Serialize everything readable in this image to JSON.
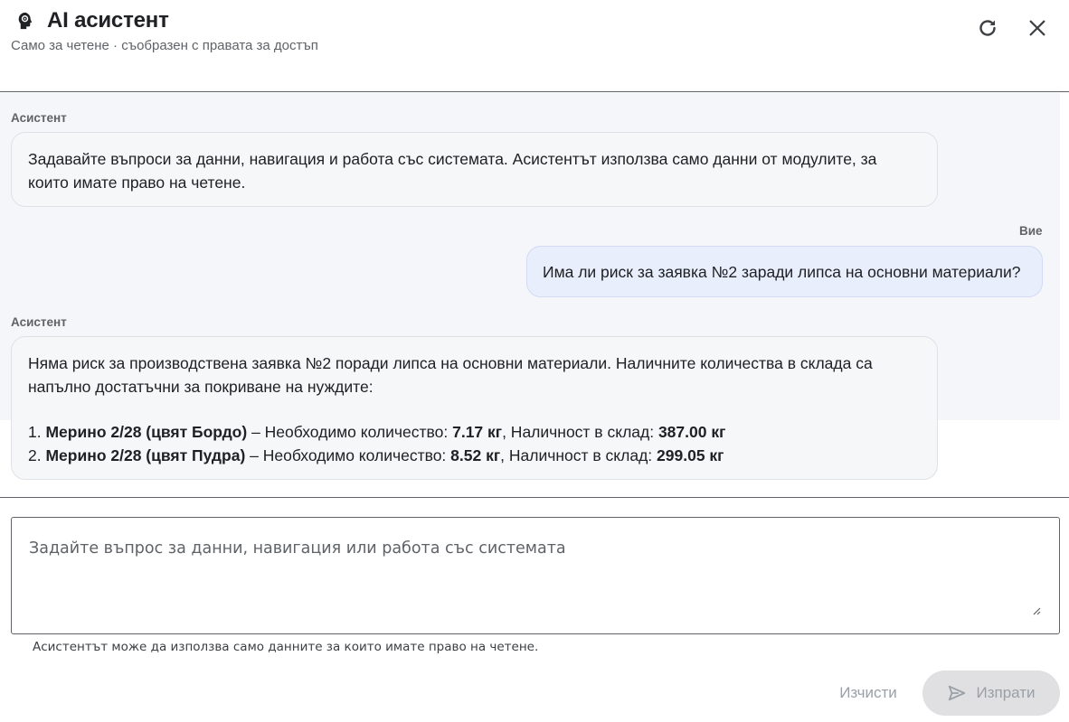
{
  "header": {
    "title": "AI асистент",
    "subtitle": "Само за четене · съобразен с правата за достъп",
    "icons": {
      "title": "brain-head-icon",
      "refresh": "refresh-icon",
      "close": "close-icon"
    }
  },
  "messages": [
    {
      "role": "assistant",
      "sender": "Асистент",
      "text": "Задавайте въпроси за данни, навигация и работа със системата. Асистентът използва само данни от модулите, за които имате право на четене."
    },
    {
      "role": "user",
      "sender": "Вие",
      "text": "Има ли риск за заявка №2 заради липса на основни материали?"
    },
    {
      "role": "assistant",
      "sender": "Асистент",
      "intro": "Няма риск за производствена заявка №2 поради липса на основни материали. Наличните количества в склада са напълно достатъчни за покриване на нуждите:",
      "items": [
        {
          "num": "1.",
          "name": "Мерино 2/28 (цвят Бордо)",
          "required_label": " – Необходимо количество: ",
          "required": "7.17 кг",
          "stock_label": ", Наличност в склад: ",
          "stock": "387.00 кг"
        },
        {
          "num": "2.",
          "name": "Мерино 2/28 (цвят Пудра)",
          "required_label": " – Необходимо количество: ",
          "required": "8.52 кг",
          "stock_label": ", Наличност в склад: ",
          "stock": "299.05 кг"
        }
      ]
    }
  ],
  "composer": {
    "placeholder": "Задайте въпрос за данни, навигация или работа със системата",
    "value": "",
    "hint": "Асистентът може да използва само данните за които имате право на четене."
  },
  "actions": {
    "clear_label": "Изчисти",
    "send_label": "Изпрати",
    "send_icon": "send-icon"
  },
  "colors": {
    "user_bubble": "#e8eefc",
    "assistant_bubble": "#f6f7f9",
    "disabled_button": "#e0e0e2"
  }
}
